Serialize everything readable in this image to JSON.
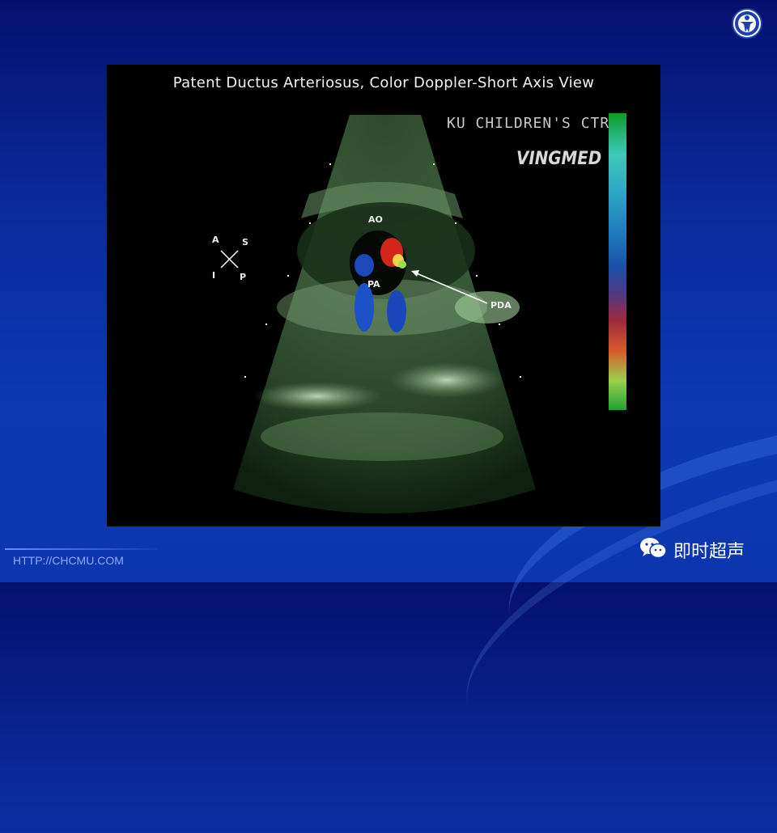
{
  "slide": {
    "background_color": "#0a2a9a",
    "footer_url": "HTTP://CHCMU.COM",
    "watermark_account": "即时超声",
    "logo_icon": "chcmu-logo-icon",
    "watermark_icon": "wechat-icon"
  },
  "echo": {
    "title": "Patent Ductus Arteriosus, Color Doppler-Short Axis View",
    "center_name": "KU CHILDREN'S CTR",
    "vendor": "VINGMED",
    "labels": {
      "ao": "AO",
      "pa": "PA",
      "pda": "PDA"
    },
    "orientation": {
      "a": "A",
      "s": "S",
      "i": "I",
      "p": "P"
    }
  }
}
